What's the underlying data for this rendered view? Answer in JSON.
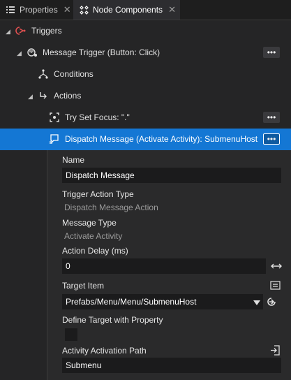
{
  "tabs": [
    {
      "label": "Properties",
      "icon": "list-icon",
      "close": "✕",
      "active": false
    },
    {
      "label": "Node Components",
      "icon": "components-icon",
      "close": "✕",
      "active": true
    }
  ],
  "tree": {
    "triggers": {
      "label": "Triggers",
      "icon": "triggers-icon"
    },
    "message_trigger": {
      "label": "Message Trigger (Button: Click)",
      "icon": "message-trigger-icon",
      "more": "•••"
    },
    "conditions": {
      "label": "Conditions",
      "icon": "conditions-icon"
    },
    "actions": {
      "label": "Actions",
      "icon": "actions-icon"
    },
    "try_set_focus": {
      "label": "Try Set Focus: \".\"",
      "icon": "focus-icon",
      "more": "•••"
    },
    "dispatch_message": {
      "label": "Dispatch Message (Activate Activity): SubmenuHost",
      "icon": "dispatch-message-icon",
      "more": "•••"
    }
  },
  "properties": {
    "name": {
      "label": "Name",
      "value": "Dispatch Message"
    },
    "trigger_action_type": {
      "label": "Trigger Action Type",
      "value": "Dispatch Message Action"
    },
    "message_type": {
      "label": "Message Type",
      "value": "Activate Activity"
    },
    "action_delay": {
      "label": "Action Delay (ms)",
      "value": "0"
    },
    "target_item": {
      "label": "Target Item",
      "value": "Prefabs/Menu/Menu/SubmenuHost"
    },
    "define_target": {
      "label": "Define Target with Property",
      "checked": false
    },
    "activity_path": {
      "label": "Activity Activation Path",
      "value": "Submenu"
    }
  },
  "colors": {
    "accent": "#1477d4",
    "background": "#252526",
    "field": "#1b1b1c"
  }
}
